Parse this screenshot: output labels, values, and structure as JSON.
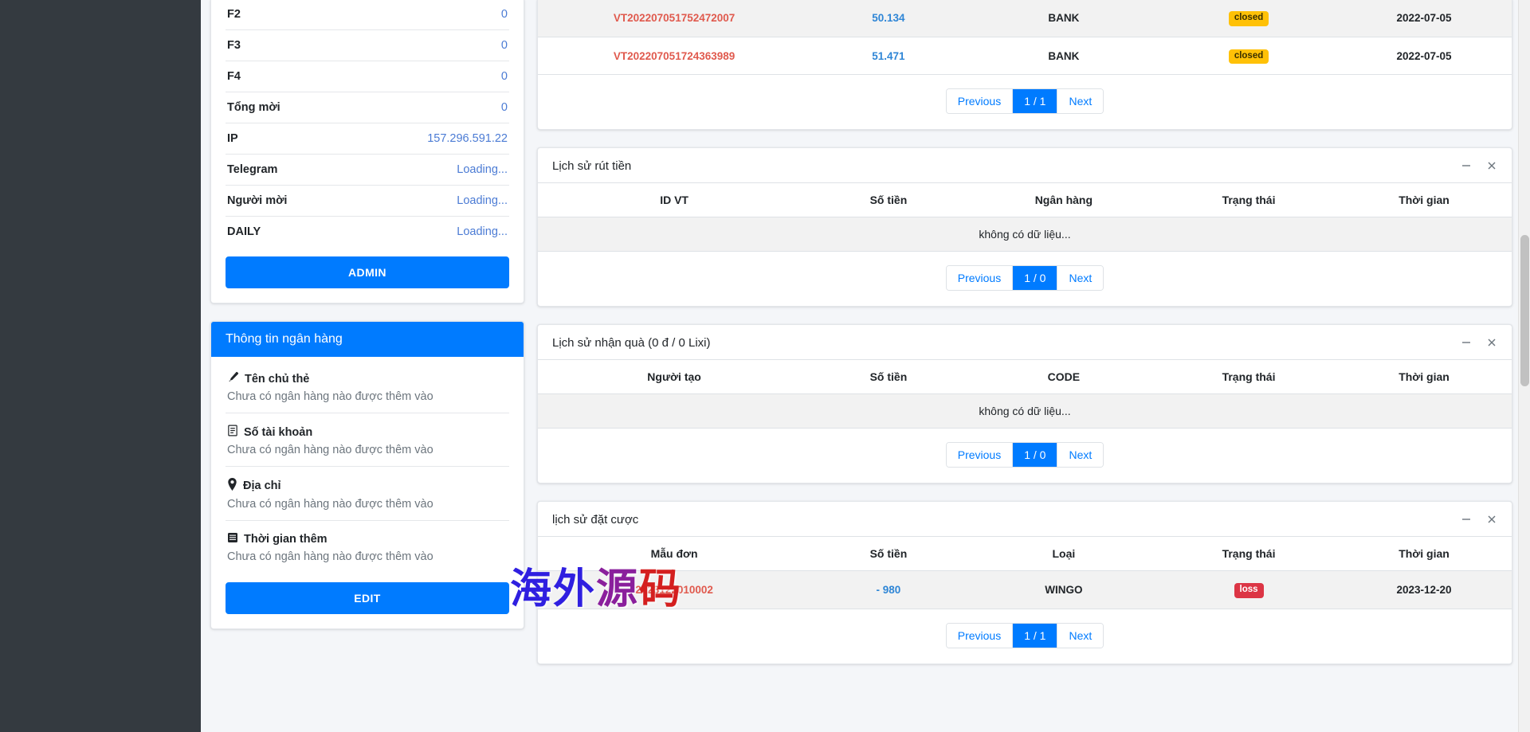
{
  "sidebar": {
    "stats": [
      {
        "label": "F2",
        "value": "0"
      },
      {
        "label": "F3",
        "value": "0"
      },
      {
        "label": "F4",
        "value": "0"
      },
      {
        "label": "Tổng mời",
        "value": "0"
      },
      {
        "label": "IP",
        "value": "157.296.591.22"
      },
      {
        "label": "Telegram",
        "value": "Loading..."
      },
      {
        "label": "Người mời",
        "value": "Loading..."
      },
      {
        "label": "DAILY",
        "value": "Loading..."
      }
    ],
    "admin_button": "ADMIN",
    "bank_card": {
      "title": "Thông tin ngân hàng",
      "items": [
        {
          "icon": "pencil-icon",
          "label": "Tên chủ thẻ",
          "value": "Chưa có ngân hàng nào được thêm vào"
        },
        {
          "icon": "document-icon",
          "label": "Số tài khoản",
          "value": "Chưa có ngân hàng nào được thêm vào"
        },
        {
          "icon": "location-pin-icon",
          "label": "Địa chỉ",
          "value": "Chưa có ngân hàng nào được thêm vào"
        },
        {
          "icon": "calendar-icon",
          "label": "Thời gian thêm",
          "value": "Chưa có ngân hàng nào được thêm vào"
        }
      ],
      "edit_button": "EDIT"
    }
  },
  "panels": [
    {
      "title": "",
      "show_head": false,
      "columns": [],
      "rows": [
        {
          "cells": [
            "VT202207051752472007",
            "50.134",
            "BANK",
            "closed",
            "2022-07-05"
          ],
          "stripe": true
        },
        {
          "cells": [
            "VT202207051724363989",
            "51.471",
            "BANK",
            "closed",
            "2022-07-05"
          ],
          "stripe": false
        }
      ],
      "empty_text": "",
      "pager": {
        "previous": "Previous",
        "page": "1 / 1",
        "next": "Next"
      }
    },
    {
      "title": "Lịch sử rút tiền",
      "show_head": true,
      "columns": [
        "ID VT",
        "Số tiền",
        "Ngân hàng",
        "Trạng thái",
        "Thời gian"
      ],
      "rows": [],
      "empty_text": "không có dữ liệu...",
      "pager": {
        "previous": "Previous",
        "page": "1 / 0",
        "next": "Next"
      }
    },
    {
      "title": "Lịch sử nhận quà (0 đ / 0 Lixi)",
      "show_head": true,
      "columns": [
        "Người tạo",
        "Số tiền",
        "CODE",
        "Trạng thái",
        "Thời gian"
      ],
      "rows": [],
      "empty_text": "không có dữ liệu...",
      "pager": {
        "previous": "Previous",
        "page": "1 / 0",
        "next": "Next"
      }
    },
    {
      "title": "lịch sử đặt cược",
      "show_head": true,
      "columns": [
        "Mẫu đơn",
        "Số tiền",
        "Loại",
        "Trạng thái",
        "Thời gian"
      ],
      "rows": [
        {
          "cells": [
            "2023122010002",
            "- 980",
            "WINGO",
            "loss",
            "2023-12-20"
          ],
          "stripe": true
        }
      ],
      "empty_text": "",
      "pager": {
        "previous": "Previous",
        "page": "1 / 1",
        "next": "Next"
      }
    }
  ],
  "watermark": {
    "part1": "海外",
    "part2": "源",
    "part3": "码"
  },
  "colors": {
    "accent": "#007bff",
    "badge_closed": "#ffc107",
    "badge_loss": "#dc3545",
    "id_red": "#e05a4e",
    "amount_blue": "#2f86d6",
    "sidebar_dark": "#343a40"
  }
}
